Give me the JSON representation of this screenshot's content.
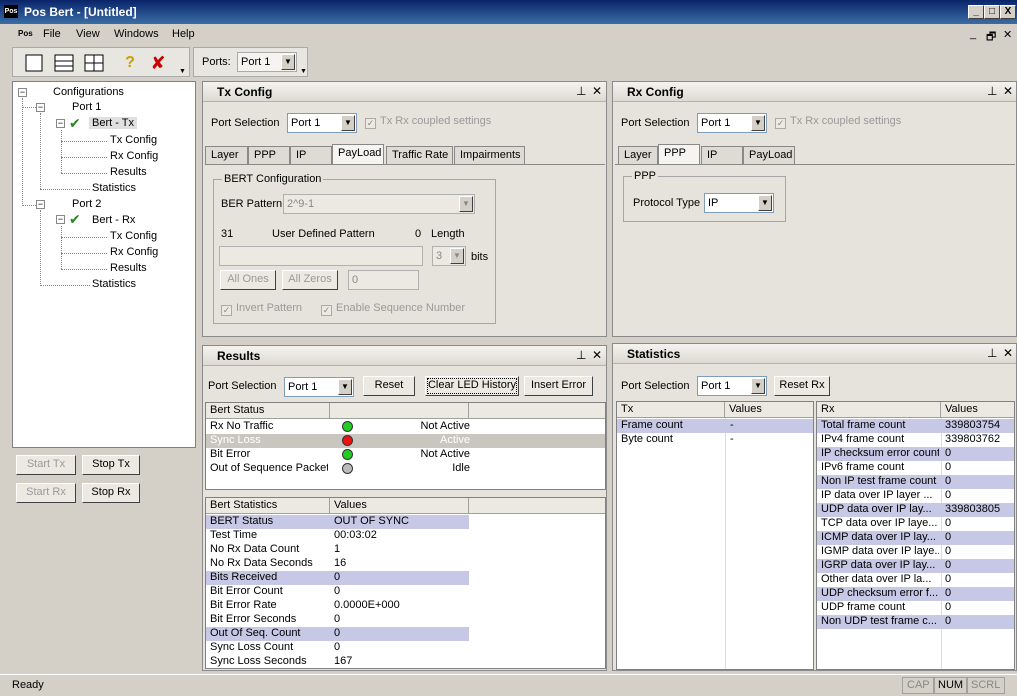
{
  "window": {
    "title": "Pos Bert - [Untitled]",
    "logo": "Pos",
    "min": "_",
    "max": "□",
    "close": "X"
  },
  "menu": [
    "File",
    "View",
    "Windows",
    "Help"
  ],
  "mdi_controls": [
    "_",
    "🗗",
    "✕"
  ],
  "toolbar": {
    "ports_label": "Ports:",
    "ports_value": "Port 1"
  },
  "tree": {
    "root": "Configurations",
    "ports": [
      {
        "label": "Port 1",
        "bert": "Bert - Tx",
        "children": [
          "Tx Config",
          "Rx Config",
          "Results"
        ],
        "stats": "Statistics"
      },
      {
        "label": "Port 2",
        "bert": "Bert - Rx",
        "children": [
          "Tx Config",
          "Rx Config",
          "Results"
        ],
        "stats": "Statistics"
      }
    ]
  },
  "left_buttons": {
    "start_tx": "Start Tx",
    "stop_tx": "Stop Tx",
    "start_rx": "Start Rx",
    "stop_rx": "Stop Rx"
  },
  "tx_config": {
    "title": "Tx Config",
    "port_label": "Port Selection",
    "port_value": "Port 1",
    "coupled": "Tx Rx coupled settings",
    "tabs": [
      "Layer",
      "PPP",
      "IP",
      "PayLoad",
      "Traffic Rate",
      "Impairments"
    ],
    "bert": {
      "group": "BERT Configuration",
      "pattern_label": "BER Pattern",
      "pattern_value": "2^9-1",
      "num_left": "31",
      "udp_label": "User Defined Pattern",
      "num_right": "0",
      "length_label": "Length",
      "length_value": "3",
      "bits": "bits",
      "pattern_text": "",
      "all_ones": "All Ones",
      "all_zeros": "All Zeros",
      "ones_value": "0",
      "invert": "Invert Pattern",
      "seq": "Enable Sequence Number"
    }
  },
  "rx_config": {
    "title": "Rx Config",
    "port_label": "Port Selection",
    "port_value": "Port 1",
    "coupled": "Tx Rx coupled settings",
    "tabs": [
      "Layer",
      "PPP",
      "IP",
      "PayLoad"
    ],
    "ppp_group": "PPP",
    "proto_label": "Protocol Type",
    "proto_value": "IP"
  },
  "results": {
    "title": "Results",
    "port_label": "Port Selection",
    "port_value": "Port 1",
    "reset": "Reset",
    "clear_led": "Clear LED History",
    "insert_error": "Insert Error",
    "status_header": "Bert Status",
    "status_rows": [
      {
        "name": "Rx No Traffic",
        "led": "#22cc22",
        "state": "Not Active"
      },
      {
        "name": "Sync Loss",
        "led": "#ee1111",
        "state": "Active"
      },
      {
        "name": "Bit Error",
        "led": "#22cc22",
        "state": "Not Active"
      },
      {
        "name": "Out of Sequence Packet",
        "led": "#bbbbbb",
        "state": "Idle"
      }
    ],
    "stats_headers": [
      "Bert Statistics",
      "Values"
    ],
    "stats_rows": [
      [
        "BERT Status",
        "OUT OF SYNC"
      ],
      [
        "Test Time",
        "00:03:02"
      ],
      [
        "No Rx Data Count",
        "1"
      ],
      [
        "No Rx Data Seconds",
        "16"
      ],
      [
        "Bits Received",
        "0"
      ],
      [
        "Bit Error Count",
        "0"
      ],
      [
        "Bit Error Rate",
        "0.0000E+000"
      ],
      [
        "Bit Error Seconds",
        "0"
      ],
      [
        "Out Of Seq. Count",
        "0"
      ],
      [
        "Sync Loss Count",
        "0"
      ],
      [
        "Sync Loss Seconds",
        "167"
      ]
    ]
  },
  "statistics": {
    "title": "Statistics",
    "port_label": "Port Selection",
    "port_value": "Port 1",
    "reset_rx": "Reset Rx",
    "tx_headers": [
      "Tx",
      "Values"
    ],
    "tx_rows": [
      [
        "Frame count",
        "-"
      ],
      [
        "Byte count",
        "-"
      ]
    ],
    "rx_headers": [
      "Rx",
      "Values"
    ],
    "rx_rows": [
      [
        "Total frame count",
        "339803754"
      ],
      [
        "IPv4 frame count",
        "339803762"
      ],
      [
        "IP checksum error count",
        "0"
      ],
      [
        "IPv6 frame count",
        "0"
      ],
      [
        "Non IP test frame count",
        "0"
      ],
      [
        "IP data over IP layer ...",
        "0"
      ],
      [
        "UDP data over IP lay...",
        "339803805"
      ],
      [
        "TCP data over IP laye...",
        "0"
      ],
      [
        "ICMP data over IP lay...",
        "0"
      ],
      [
        "IGMP data over IP laye...",
        "0"
      ],
      [
        "IGRP data over IP lay...",
        "0"
      ],
      [
        "Other data over IP la...",
        "0"
      ],
      [
        "UDP checksum error f...",
        "0"
      ],
      [
        "UDP frame count",
        "0"
      ],
      [
        "Non UDP test frame c...",
        "0"
      ]
    ]
  },
  "status": {
    "text": "Ready",
    "cap": "CAP",
    "num": "NUM",
    "scrl": "SCRL"
  },
  "colors": {
    "title_bar": "#0a246a",
    "highlight_row": "#c7c7e6",
    "accent_check": "#cc0000"
  }
}
